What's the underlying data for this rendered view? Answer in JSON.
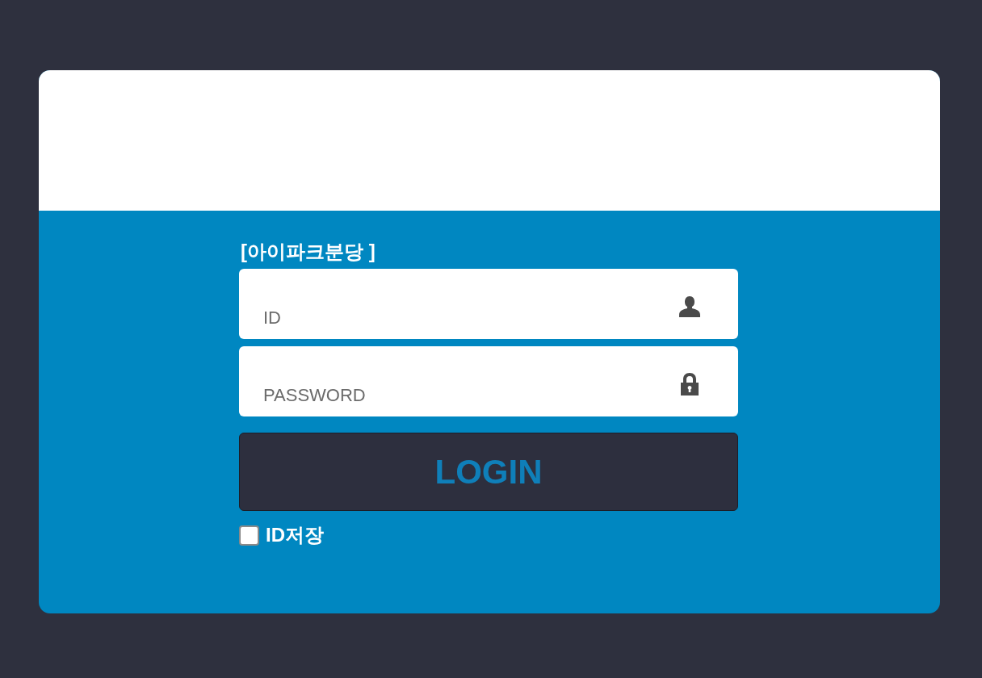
{
  "branch_title": "[아이파크분당 ]",
  "fields": [
    {
      "kind": "id",
      "placeholder": "ID"
    },
    {
      "kind": "password",
      "placeholder": "PASSWORD"
    }
  ],
  "login_button": {
    "label": "LOGIN"
  },
  "remember_id": {
    "label": "ID저장",
    "checked": false
  }
}
